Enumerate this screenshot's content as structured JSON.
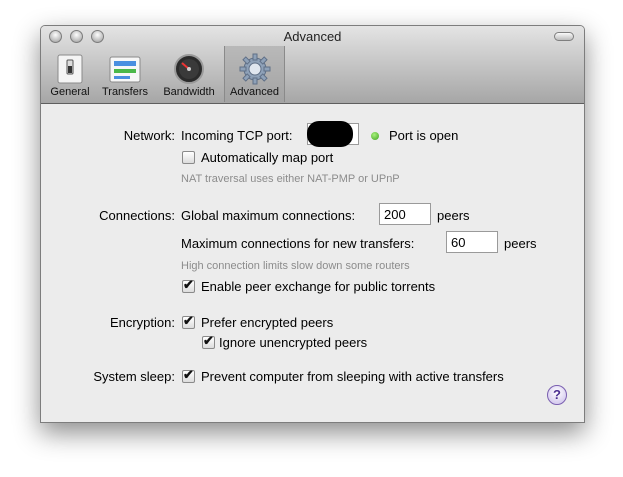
{
  "window": {
    "title": "Advanced"
  },
  "toolbar": {
    "items": [
      {
        "label": "General",
        "icon": "general-icon"
      },
      {
        "label": "Transfers",
        "icon": "transfers-icon"
      },
      {
        "label": "Bandwidth",
        "icon": "bandwidth-icon"
      },
      {
        "label": "Advanced",
        "icon": "gear-icon",
        "selected": true
      }
    ]
  },
  "network": {
    "label": "Network:",
    "port_label": "Incoming TCP port:",
    "port_status": "Port is open",
    "status_color": "#3fa320",
    "auto_map_label": "Automatically map port",
    "auto_map_checked": false,
    "hint": "NAT traversal uses either NAT-PMP or UPnP"
  },
  "connections": {
    "label": "Connections:",
    "global_label": "Global maximum connections:",
    "global_value": "200",
    "global_unit": "peers",
    "per_transfer_label": "Maximum connections for new transfers:",
    "per_transfer_value": "60",
    "per_transfer_unit": "peers",
    "hint": "High connection limits slow down some routers",
    "pex_label": "Enable peer exchange for public torrents",
    "pex_checked": true
  },
  "encryption": {
    "label": "Encryption:",
    "prefer_label": "Prefer encrypted peers",
    "prefer_checked": true,
    "ignore_label": "Ignore unencrypted peers",
    "ignore_checked": true
  },
  "sleep": {
    "label": "System sleep:",
    "prevent_label": "Prevent computer from sleeping with active transfers",
    "prevent_checked": true
  },
  "help": {
    "glyph": "?"
  },
  "check_glyph": "✔"
}
